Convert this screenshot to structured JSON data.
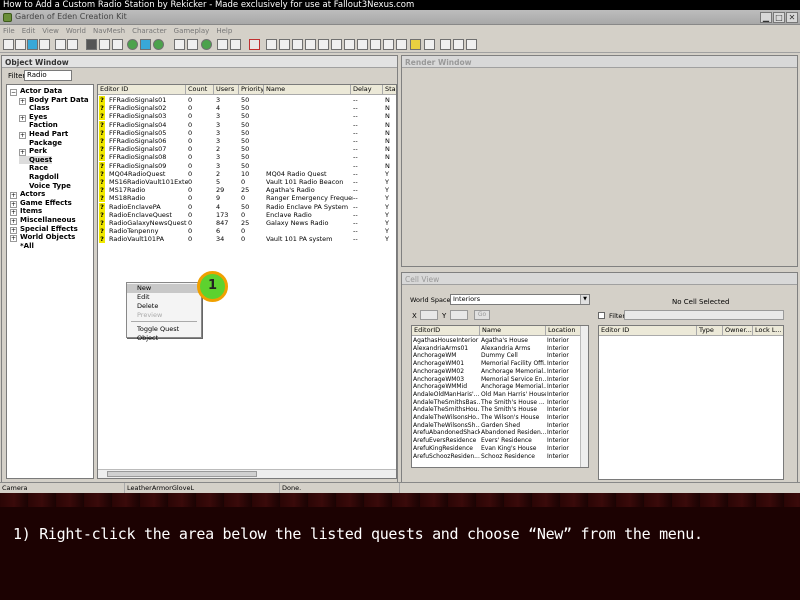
{
  "tutorial_title": "How to Add a Custom Radio Station by Rekicker - Made exclusively for use at Fallout3Nexus.com",
  "app_title": "Garden of Eden Creation Kit",
  "menu": [
    "File",
    "Edit",
    "View",
    "World",
    "NavMesh",
    "Character",
    "Gameplay",
    "Help"
  ],
  "object_window": {
    "title": "Object Window",
    "filter_label": "Filter",
    "filter_value": "Radio",
    "tree": [
      {
        "label": "Actor Data",
        "level": 0,
        "expander": "−"
      },
      {
        "label": "Body Part Data",
        "level": 1,
        "expander": "+"
      },
      {
        "label": "Class",
        "level": 1,
        "expander": ""
      },
      {
        "label": "Eyes",
        "level": 1,
        "expander": "+"
      },
      {
        "label": "Faction",
        "level": 1,
        "expander": ""
      },
      {
        "label": "Head Part",
        "level": 1,
        "expander": "+"
      },
      {
        "label": "Package",
        "level": 1,
        "expander": ""
      },
      {
        "label": "Perk",
        "level": 1,
        "expander": "+"
      },
      {
        "label": "Quest",
        "level": 1,
        "expander": "",
        "selected": true
      },
      {
        "label": "Race",
        "level": 1,
        "expander": ""
      },
      {
        "label": "Ragdoll",
        "level": 1,
        "expander": ""
      },
      {
        "label": "Voice Type",
        "level": 1,
        "expander": ""
      },
      {
        "label": "Actors",
        "level": 0,
        "expander": "+"
      },
      {
        "label": "Game Effects",
        "level": 0,
        "expander": "+"
      },
      {
        "label": "Items",
        "level": 0,
        "expander": "+"
      },
      {
        "label": "Miscellaneous",
        "level": 0,
        "expander": "+"
      },
      {
        "label": "Special Effects",
        "level": 0,
        "expander": "+"
      },
      {
        "label": "World Objects",
        "level": 0,
        "expander": "+"
      },
      {
        "label": "*All",
        "level": 0,
        "expander": ""
      }
    ],
    "columns": [
      "Editor ID",
      "Count",
      "Users",
      "Priority",
      "Name",
      "Delay",
      "Start"
    ],
    "rows": [
      [
        "FFRadioSignals01",
        "0",
        "3",
        "50",
        "",
        "--",
        "N"
      ],
      [
        "FFRadioSignals02",
        "0",
        "4",
        "50",
        "",
        "--",
        "N"
      ],
      [
        "FFRadioSignals03",
        "0",
        "3",
        "50",
        "",
        "--",
        "N"
      ],
      [
        "FFRadioSignals04",
        "0",
        "3",
        "50",
        "",
        "--",
        "N"
      ],
      [
        "FFRadioSignals05",
        "0",
        "3",
        "50",
        "",
        "--",
        "N"
      ],
      [
        "FFRadioSignals06",
        "0",
        "3",
        "50",
        "",
        "--",
        "N"
      ],
      [
        "FFRadioSignals07",
        "0",
        "2",
        "50",
        "",
        "--",
        "N"
      ],
      [
        "FFRadioSignals08",
        "0",
        "3",
        "50",
        "",
        "--",
        "N"
      ],
      [
        "FFRadioSignals09",
        "0",
        "3",
        "50",
        "",
        "--",
        "N"
      ],
      [
        "MQ04RadioQuest",
        "0",
        "2",
        "10",
        "MQ04 Radio Quest",
        "--",
        "Y"
      ],
      [
        "MS16RadioVault101External",
        "0",
        "5",
        "0",
        "Vault 101 Radio Beacon",
        "--",
        "Y"
      ],
      [
        "MS17Radio",
        "0",
        "29",
        "25",
        "Agatha's Radio",
        "--",
        "Y"
      ],
      [
        "MS18Radio",
        "0",
        "9",
        "0",
        "Ranger Emergency Frequency",
        "--",
        "Y"
      ],
      [
        "RadioEnclavePA",
        "0",
        "4",
        "50",
        "Radio Enclave PA System",
        "--",
        "Y"
      ],
      [
        "RadioEnclaveQuest",
        "0",
        "173",
        "0",
        "Enclave Radio",
        "--",
        "Y"
      ],
      [
        "RadioGalaxyNewsQuest",
        "0",
        "847",
        "25",
        "Galaxy News Radio",
        "--",
        "Y"
      ],
      [
        "RadioTenpenny",
        "0",
        "6",
        "0",
        "",
        "--",
        "Y"
      ],
      [
        "RadioVault101PA",
        "0",
        "34",
        "0",
        "Vault 101 PA system",
        "--",
        "Y"
      ]
    ]
  },
  "context_menu": {
    "items": [
      {
        "label": "New",
        "state": "highlighted"
      },
      {
        "label": "Edit",
        "state": "normal"
      },
      {
        "label": "Delete",
        "state": "normal"
      },
      {
        "label": "Preview",
        "state": "disabled"
      },
      {
        "label": "Toggle Quest Object",
        "state": "normal"
      }
    ]
  },
  "step_badge": "1",
  "render_window": {
    "title": "Render Window"
  },
  "cell_view": {
    "title": "Cell View",
    "world_space_label": "World Space",
    "world_space_value": "Interiors",
    "x_label": "X",
    "y_label": "Y",
    "go_label": "Go",
    "no_cell": "No Cell Selected",
    "filter_label": "Filter",
    "columns": [
      "EditorID",
      "Name",
      "Location"
    ],
    "rows": [
      [
        "AgathasHouseInterior",
        "Agatha's House",
        "Interior"
      ],
      [
        "AlexandriaArms01",
        "Alexandria Arms",
        "Interior"
      ],
      [
        "AnchorageWM",
        "Dummy Cell",
        "Interior"
      ],
      [
        "AnchorageWM01",
        "Memorial Facility Offi...",
        "Interior"
      ],
      [
        "AnchorageWM02",
        "Anchorage Memorial...",
        "Interior"
      ],
      [
        "AnchorageWM03",
        "Memorial Service En...",
        "Interior"
      ],
      [
        "AnchorageWMMid",
        "Anchorage Memorial...",
        "Interior"
      ],
      [
        "AndaleOldManHaris'...",
        "Old Man Harris' House",
        "Interior"
      ],
      [
        "AndaleTheSmithsBas...",
        "The Smith's House ...",
        "Interior"
      ],
      [
        "AndaleTheSmithsHou...",
        "The Smith's House",
        "Interior"
      ],
      [
        "AndaleTheWilsonsHo...",
        "The Wilson's House",
        "Interior"
      ],
      [
        "AndaleTheWilsonsSh...",
        "Garden Shed",
        "Interior"
      ],
      [
        "ArefuAbandonedShack",
        "Abandoned Residen...",
        "Interior"
      ],
      [
        "ArefuEversResidence",
        "Evers' Residence",
        "Interior"
      ],
      [
        "ArefuKingResidence",
        "Evan King's House",
        "Interior"
      ],
      [
        "ArefuSchoozResiden...",
        "Schooz Residence",
        "Interior"
      ]
    ],
    "ref_columns": [
      "Editor ID",
      "Type",
      "Owner...",
      "Lock L..."
    ]
  },
  "status_bar": [
    "Camera",
    "LeatherArmorGloveL",
    "Done."
  ],
  "caption": "1) Right-click the area below the listed quests and choose “New” from the menu."
}
